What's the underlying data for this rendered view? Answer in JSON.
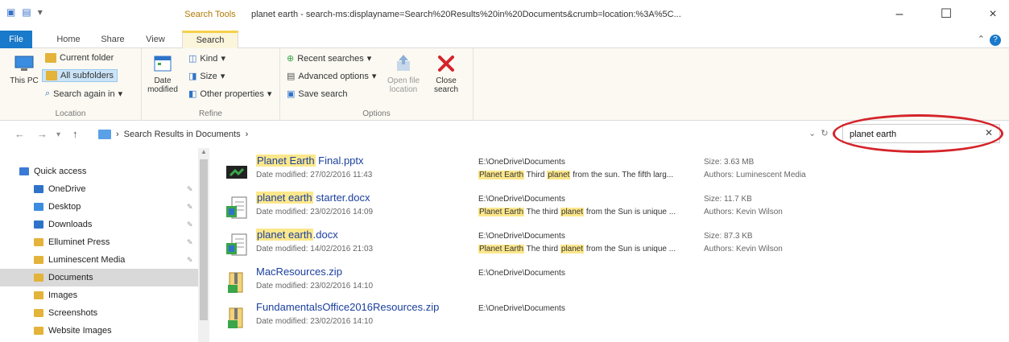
{
  "titlebar": {
    "context_tab_label": "Search Tools",
    "title": "planet earth - search-ms:displayname=Search%20Results%20in%20Documents&crumb=location:%3A%5C...",
    "minimize": "–",
    "maximize": "☐",
    "close": "×"
  },
  "tabs": {
    "file": "File",
    "home": "Home",
    "share": "Share",
    "view": "View",
    "search": "Search"
  },
  "ribbon": {
    "location": {
      "this_pc": "This PC",
      "current_folder": "Current folder",
      "all_subfolders": "All subfolders",
      "search_again": "Search again in",
      "label": "Location"
    },
    "refine": {
      "date_modified": "Date modified",
      "kind": "Kind",
      "size": "Size",
      "other_properties": "Other properties",
      "label": "Refine"
    },
    "options": {
      "recent_searches": "Recent searches",
      "advanced_options": "Advanced options",
      "save_search": "Save search",
      "open_file_location": "Open file location",
      "close_search": "Close search",
      "label": "Options"
    }
  },
  "address": {
    "breadcrumb": "Search Results in Documents",
    "search_value": "planet earth"
  },
  "navpane": {
    "items": [
      {
        "label": "Quick access",
        "color": "#3a7bd5"
      },
      {
        "label": "OneDrive",
        "color": "#2f73c9"
      },
      {
        "label": "Desktop",
        "color": "#3b8de0"
      },
      {
        "label": "Downloads",
        "color": "#2f73c9"
      },
      {
        "label": "Elluminet Press",
        "color": "#e3b33a"
      },
      {
        "label": "Luminescent Media",
        "color": "#e3b33a"
      },
      {
        "label": "Documents",
        "color": "#e3b33a"
      },
      {
        "label": "Images",
        "color": "#e3b33a"
      },
      {
        "label": "Screenshots",
        "color": "#e3b33a"
      },
      {
        "label": "Website Images",
        "color": "#e3b33a"
      }
    ]
  },
  "results": [
    {
      "name_hl": "Planet Earth",
      "name_rest": " Final.pptx",
      "date": "Date modified: 27/02/2016 11:43",
      "path": "E:\\OneDrive\\Documents",
      "snip_hl1": "Planet Earth",
      "snip_mid": " Third ",
      "snip_hl2": "planet",
      "snip_rest": " from the sun. The fifth larg...",
      "size": "Size: 3.63 MB",
      "author": "Authors: Luminescent Media",
      "icon": "powerpoint-icon"
    },
    {
      "name_hl": "planet earth",
      "name_rest": " starter.docx",
      "date": "Date modified: 23/02/2016 14:09",
      "path": "E:\\OneDrive\\Documents",
      "snip_hl1": "Planet Earth",
      "snip_mid": " The third ",
      "snip_hl2": "planet",
      "snip_rest": " from the Sun is unique ...",
      "size": "Size: 11.7 KB",
      "author": "Authors: Kevin Wilson",
      "icon": "word-doc-icon"
    },
    {
      "name_hl": "planet earth",
      "name_rest": ".docx",
      "date": "Date modified: 14/02/2016 21:03",
      "path": "E:\\OneDrive\\Documents",
      "snip_hl1": "Planet Earth",
      "snip_mid": " The third ",
      "snip_hl2": "planet",
      "snip_rest": " from the Sun is unique ...",
      "size": "Size: 87.3 KB",
      "author": "Authors: Kevin Wilson",
      "icon": "word-doc-icon"
    },
    {
      "name_hl": "",
      "name_rest": "MacResources.zip",
      "date": "Date modified: 23/02/2016 14:10",
      "path": "E:\\OneDrive\\Documents",
      "snip_hl1": "",
      "snip_mid": "",
      "snip_hl2": "",
      "snip_rest": "",
      "size": "",
      "author": "",
      "icon": "zip-folder-icon"
    },
    {
      "name_hl": "",
      "name_rest": "FundamentalsOffice2016Resources.zip",
      "date": "Date modified: 23/02/2016 14:10",
      "path": "E:\\OneDrive\\Documents",
      "snip_hl1": "",
      "snip_mid": "",
      "snip_hl2": "",
      "snip_rest": "",
      "size": "",
      "author": "",
      "icon": "zip-folder-icon"
    }
  ]
}
